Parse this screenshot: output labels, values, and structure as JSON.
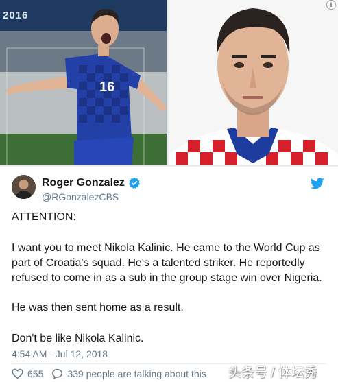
{
  "photos": {
    "banner_text": "2016"
  },
  "tweet": {
    "author_name": "Roger Gonzalez",
    "author_handle": "@RGonzalezCBS",
    "lines": [
      "ATTENTION:",
      "I want you to meet Nikola Kalinic. He came to the World Cup as",
      "part of Croatia's squad. He's a talented striker. He reportedly",
      "refused to come in as a sub in the group stage win over Nigeria.",
      "He was then sent home as a result.",
      "Don't be like Nikola Kalinic."
    ],
    "timestamp": "4:54 AM - Jul 12, 2018",
    "likes": "655",
    "talking": "339 people are talking about this"
  },
  "jersey_number": "16",
  "watermark": "头条号 / 体坛秀",
  "icons": {
    "verified": "verified-badge-icon",
    "bird": "twitter-bird-icon",
    "heart": "heart-icon",
    "talk": "speech-bubble-icon",
    "info": "info-icon"
  },
  "colors": {
    "twitter_blue": "#1da1f2",
    "text": "#14171a",
    "muted": "#657786",
    "croatia_blue": "#2240a6",
    "croatia_red": "#d6202b"
  }
}
